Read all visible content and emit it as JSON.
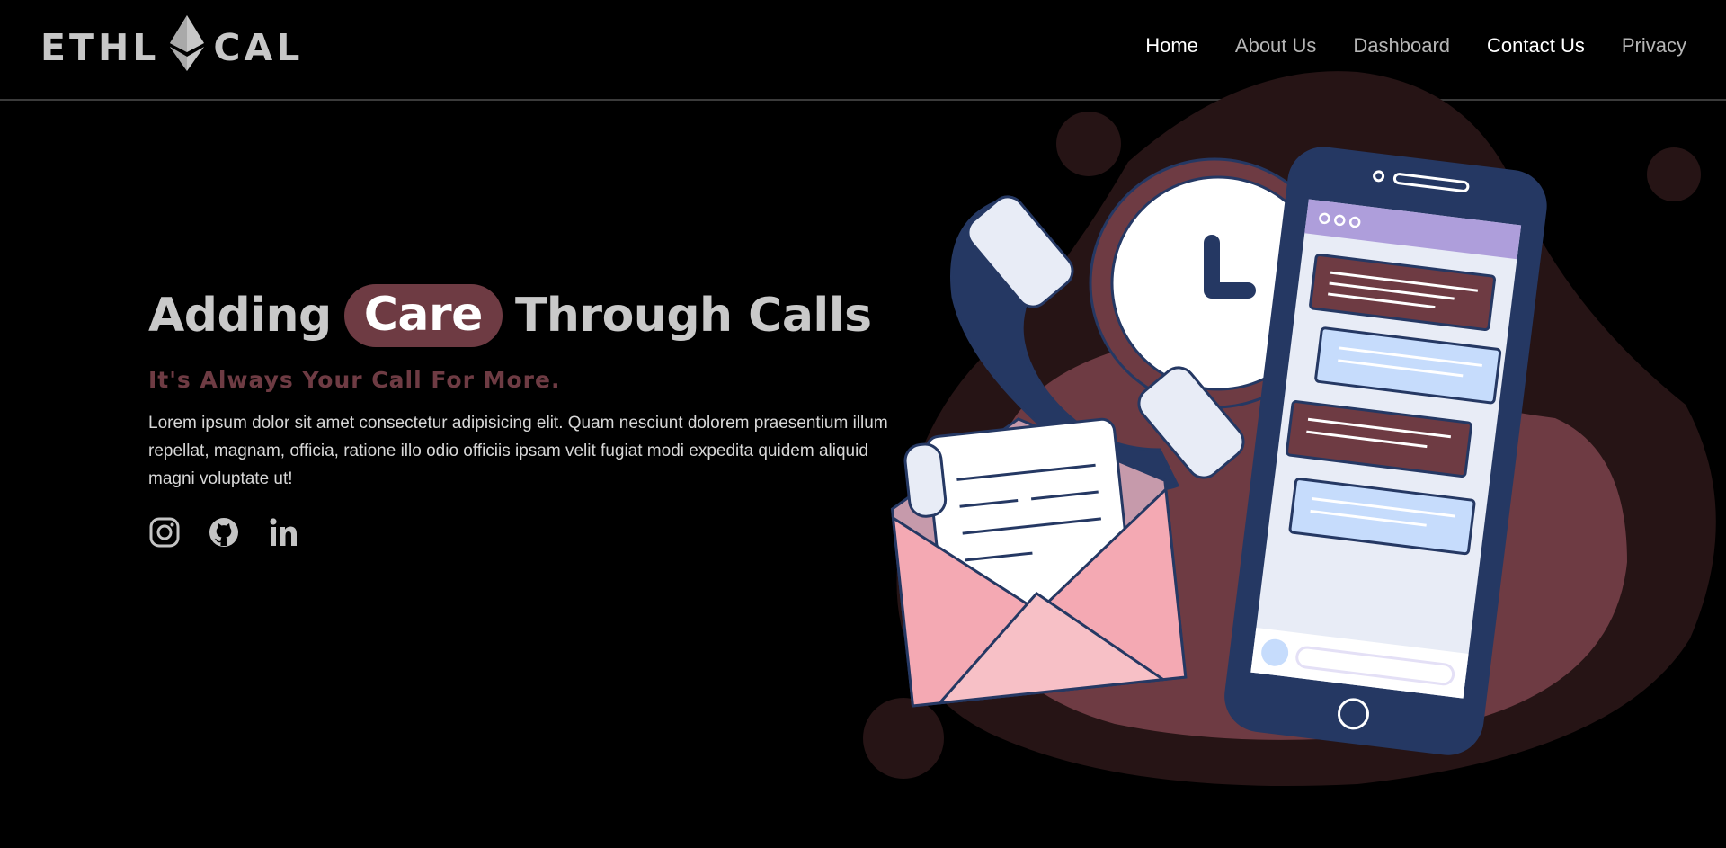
{
  "header": {
    "logo_left": "ETHL",
    "logo_right": "CAL",
    "nav": [
      {
        "label": "Home"
      },
      {
        "label": "About Us"
      },
      {
        "label": "Dashboard"
      },
      {
        "label": "Contact Us"
      },
      {
        "label": "Privacy"
      }
    ]
  },
  "hero": {
    "headline_pre": "Adding",
    "headline_highlight": "Care",
    "headline_post": "Through Calls",
    "tagline": "It's Always Your Call For More.",
    "description": "Lorem ipsum dolor sit amet consectetur adipisicing elit. Quam nesciunt dolorem praesentium illum repellat, magnam, officia, ratione illo odio officiis ipsam velit fugiat modi expedita quidem aliquid magni voluptate ut!"
  },
  "socials": [
    {
      "icon": "instagram-icon"
    },
    {
      "icon": "github-icon"
    },
    {
      "icon": "linkedin-icon"
    }
  ],
  "colors": {
    "background": "#000000",
    "accent": "#6e3b43",
    "text_muted": "#c9c9c9",
    "phone_navy": "#253863",
    "envelope_pink": "#f4a9b3"
  }
}
